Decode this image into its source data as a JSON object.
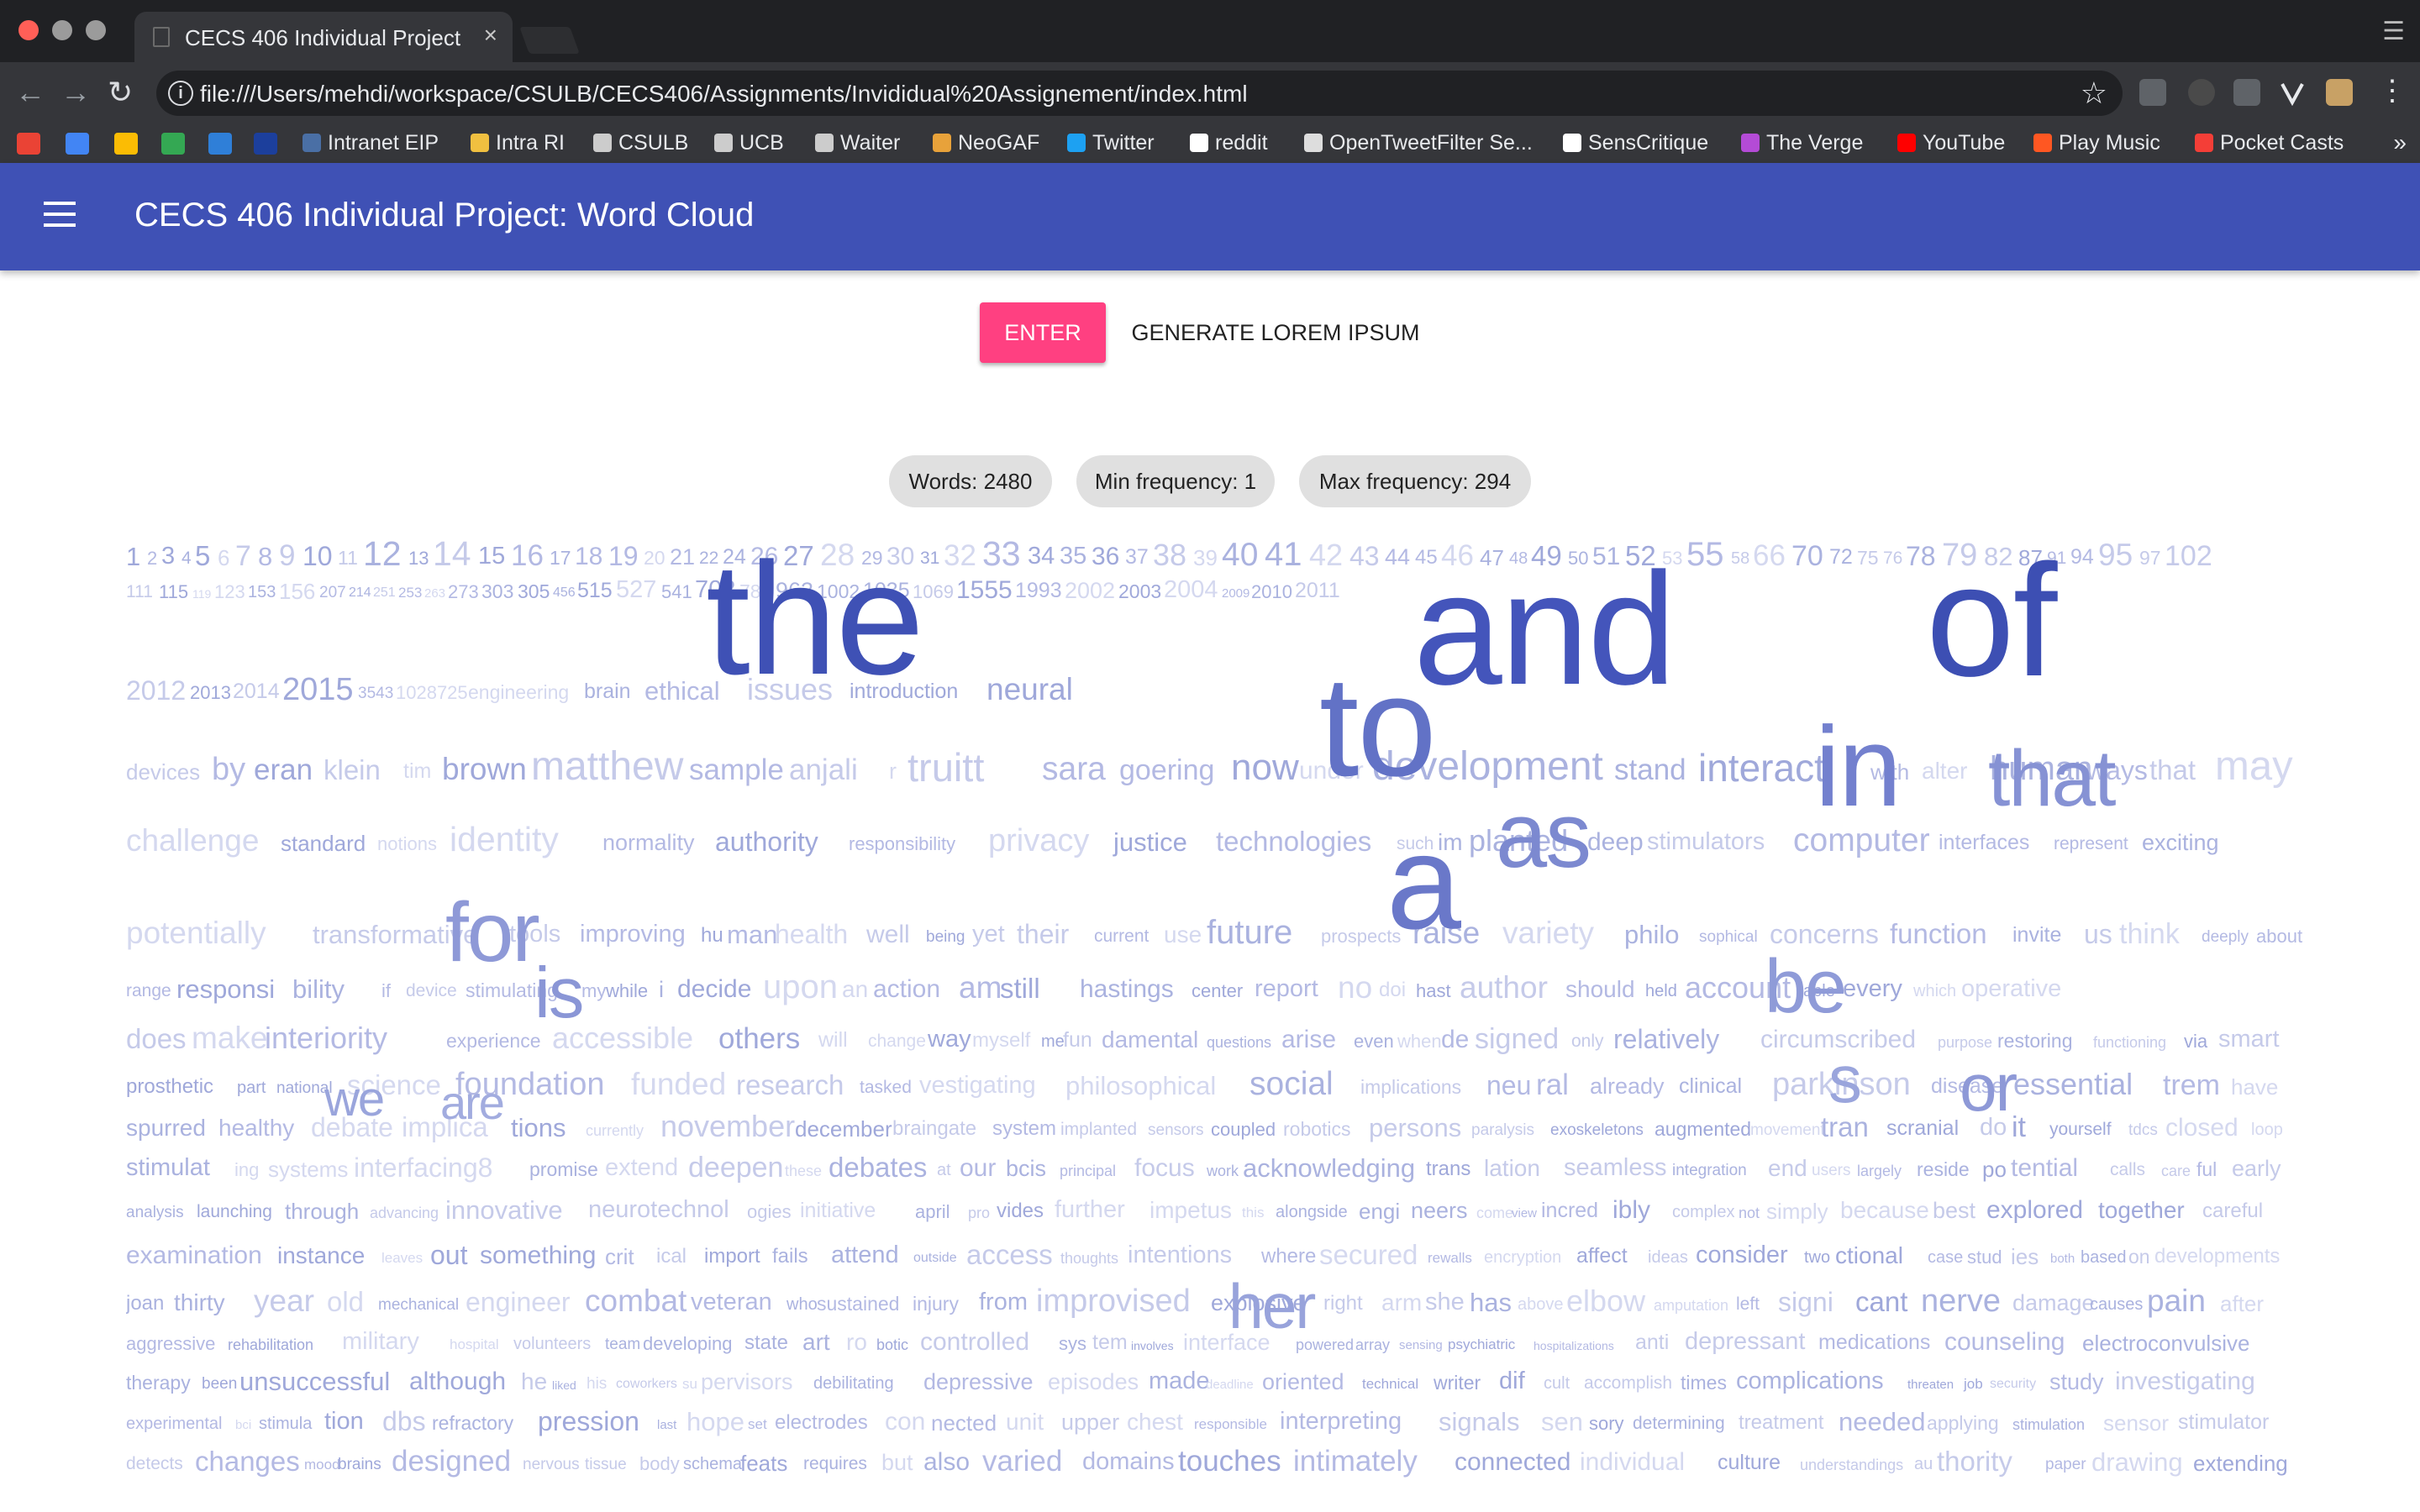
{
  "browser": {
    "tab_title": "CECS 406 Individual Project",
    "tab_close": "×",
    "url": "file:///Users/mehdi/workspace/CSULB/CECS406/Assignments/Invididual%20Assignement/index.html",
    "info_glyph": "i",
    "star_glyph": "☆",
    "menu_glyph": "⋮",
    "back_glyph": "←",
    "forward_glyph": "→",
    "reload_glyph": "↻",
    "profile_glyph": "☰",
    "bookmarks": [
      {
        "label": "Intranet EIP",
        "color": "#4a6fa5"
      },
      {
        "label": "Intra RI",
        "color": "#f0c040"
      },
      {
        "label": "CSULB",
        "color": "#cccccc"
      },
      {
        "label": "UCB",
        "color": "#cccccc"
      },
      {
        "label": "Waiter",
        "color": "#cccccc"
      },
      {
        "label": "NeoGAF",
        "color": "#e8a23a"
      },
      {
        "label": "Twitter",
        "color": "#1da1f2"
      },
      {
        "label": "reddit",
        "color": "#ffffff"
      },
      {
        "label": "OpenTweetFilter Se...",
        "color": "#dddddd"
      },
      {
        "label": "SensCritique",
        "color": "#ffffff"
      },
      {
        "label": "The Verge",
        "color": "#b44bd6"
      },
      {
        "label": "YouTube",
        "color": "#ff0000"
      },
      {
        "label": "Play Music",
        "color": "#ff5722"
      },
      {
        "label": "Pocket Casts",
        "color": "#f43e37"
      }
    ],
    "more_glyph": "»"
  },
  "app": {
    "title": "CECS 406 Individual Project: Word Cloud",
    "primary_color": "#3f51b5",
    "accent_color": "#ff4081",
    "enter_label": "ENTER",
    "lorem_label": "GENERATE LOREM IPSUM",
    "chips": {
      "words": "Words: 2480",
      "min": "Min frequency: 1",
      "max": "Max frequency: 294"
    }
  },
  "cloud": {
    "big_words": [
      "the",
      "and",
      "of",
      "to",
      "in",
      "that",
      "as",
      "a",
      "for",
      "is",
      "be",
      "s",
      "or",
      "her",
      "we",
      "are"
    ],
    "lines": [
      "1 2 3 4 5 6 7 8 9 10 11 12 13 14 15 16 17 18 19 20 21 22 24 26 27 28 29 30 31 32 33 34 35 36 37 38 39 40 41 42 43 44 45 46 47 48 49 50 51 52 53 55 58 66 70 72 75 76 78 79 82 87 91 94 95 97 102",
      "111 115 119 123 153 156 207 214 251 253 263 273 303 305 456 515 527 541 702 785 963 1002 1035 1069 1555 1993 2002 2003 2004 2009 2010 2011",
      "2012 2013 2014 2015 3543 1028725 engineering brain ethical issues introduction neural",
      "devices by eran klein tim brown matthew sample anjali r truitt sara goering now under development stand interact with alter human ways that may",
      "challenge standard notions identity normality authority responsibility privacy justice technologies such im planted deep stimulators computer interfaces represent exciting",
      "potentially transformative tools improving hu man health well being yet their current use future prospects raise variety philo sophical concerns function invite us think deeply about",
      "range responsi bility if device stimulating my while i decide upon an action am still hastings center report no doi hast author should held account able every which operative",
      "does make interiority experience accessible others will change way myself me fun damental questions arise even when de signed only relatively circumscribed purpose restoring functioning via smart",
      "prosthetic part national science foundation funded research tasked vestigating philosophical social implications neu ral already clinical parkinson disease essential trem have",
      "spurred healthy debate implica tions currently november december braingate system implanted sensors coupled robotics persons paralysis exoskeletons augmented movement tran scranial do it yourself tdcs closed loop",
      "stimulat ing systems interfacing8 promise extend deepen these debates at our bcis principal focus work acknowledging trans lation seamless integration end users largely reside po tential calls care ful early",
      "analysis launching through advancing innovative neurotechnol ogies initiative april pro vides further impetus this alongside engi neers come view incred ibly complex not simply because best explored together careful",
      "examination instance leaves out something crit ical import fails attend outside access thoughts intentions where secured rewalls encryption affect ideas consider two ctional case stud ies both based on developments",
      "joan thirty year old mechanical engineer combat veteran who sustained injury from improvised explosive right arm she has above elbow amputation left signi cant nerve damage causes pain after",
      "aggressive rehabilitation military hospital volunteers team developing state art ro botic controlled sys tem involves interface powered array sensing psychiatric hospitalizations anti depressant medications counseling electroconvulsive",
      "therapy been unsuccessful although he liked his coworkers su pervisors debilitating depressive episodes made deadline oriented technical writer dif cult accomplish times complications threaten job security study investigating",
      "experimental bci stimula tion dbs refractory pression last hope set electrodes con nected unit upper chest responsible interpreting signals sen sory determining treatment needed applying stimulation sensor stimulator",
      "detects changes mood brains designed nervous tissue body schema feats requires but also varied domains touches intimately connected individual culture understandings au thority paper drawing extending"
    ]
  }
}
